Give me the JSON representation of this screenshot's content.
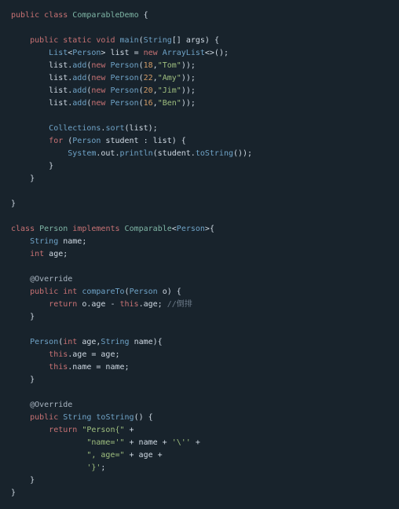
{
  "code": {
    "tokens": [
      {
        "c": "kw",
        "t": "public"
      },
      {
        "c": "pn",
        "t": " "
      },
      {
        "c": "kw",
        "t": "class"
      },
      {
        "c": "pn",
        "t": " "
      },
      {
        "c": "type",
        "t": "ComparableDemo"
      },
      {
        "c": "pn",
        "t": " {\n\n"
      },
      {
        "c": "pn",
        "t": "    "
      },
      {
        "c": "kw",
        "t": "public"
      },
      {
        "c": "pn",
        "t": " "
      },
      {
        "c": "kw",
        "t": "static"
      },
      {
        "c": "pn",
        "t": " "
      },
      {
        "c": "kw",
        "t": "void"
      },
      {
        "c": "pn",
        "t": " "
      },
      {
        "c": "fn",
        "t": "main"
      },
      {
        "c": "pn",
        "t": "("
      },
      {
        "c": "typeblue",
        "t": "String"
      },
      {
        "c": "pn",
        "t": "[] args) {\n"
      },
      {
        "c": "pn",
        "t": "        "
      },
      {
        "c": "typeblue",
        "t": "List"
      },
      {
        "c": "pn",
        "t": "<"
      },
      {
        "c": "typeblue",
        "t": "Person"
      },
      {
        "c": "pn",
        "t": "> list = "
      },
      {
        "c": "kw",
        "t": "new"
      },
      {
        "c": "pn",
        "t": " "
      },
      {
        "c": "typeblue",
        "t": "ArrayList"
      },
      {
        "c": "pn",
        "t": "<>();\n"
      },
      {
        "c": "pn",
        "t": "        list."
      },
      {
        "c": "fn",
        "t": "add"
      },
      {
        "c": "pn",
        "t": "("
      },
      {
        "c": "kw",
        "t": "new"
      },
      {
        "c": "pn",
        "t": " "
      },
      {
        "c": "typeblue",
        "t": "Person"
      },
      {
        "c": "pn",
        "t": "("
      },
      {
        "c": "num",
        "t": "18"
      },
      {
        "c": "pn",
        "t": ","
      },
      {
        "c": "str",
        "t": "\"Tom\""
      },
      {
        "c": "pn",
        "t": "));\n"
      },
      {
        "c": "pn",
        "t": "        list."
      },
      {
        "c": "fn",
        "t": "add"
      },
      {
        "c": "pn",
        "t": "("
      },
      {
        "c": "kw",
        "t": "new"
      },
      {
        "c": "pn",
        "t": " "
      },
      {
        "c": "typeblue",
        "t": "Person"
      },
      {
        "c": "pn",
        "t": "("
      },
      {
        "c": "num",
        "t": "22"
      },
      {
        "c": "pn",
        "t": ","
      },
      {
        "c": "str",
        "t": "\"Amy\""
      },
      {
        "c": "pn",
        "t": "));\n"
      },
      {
        "c": "pn",
        "t": "        list."
      },
      {
        "c": "fn",
        "t": "add"
      },
      {
        "c": "pn",
        "t": "("
      },
      {
        "c": "kw",
        "t": "new"
      },
      {
        "c": "pn",
        "t": " "
      },
      {
        "c": "typeblue",
        "t": "Person"
      },
      {
        "c": "pn",
        "t": "("
      },
      {
        "c": "num",
        "t": "20"
      },
      {
        "c": "pn",
        "t": ","
      },
      {
        "c": "str",
        "t": "\"Jim\""
      },
      {
        "c": "pn",
        "t": "));\n"
      },
      {
        "c": "pn",
        "t": "        list."
      },
      {
        "c": "fn",
        "t": "add"
      },
      {
        "c": "pn",
        "t": "("
      },
      {
        "c": "kw",
        "t": "new"
      },
      {
        "c": "pn",
        "t": " "
      },
      {
        "c": "typeblue",
        "t": "Person"
      },
      {
        "c": "pn",
        "t": "("
      },
      {
        "c": "num",
        "t": "16"
      },
      {
        "c": "pn",
        "t": ","
      },
      {
        "c": "str",
        "t": "\"Ben\""
      },
      {
        "c": "pn",
        "t": "));\n\n"
      },
      {
        "c": "pn",
        "t": "        "
      },
      {
        "c": "typeblue",
        "t": "Collections"
      },
      {
        "c": "pn",
        "t": "."
      },
      {
        "c": "fn",
        "t": "sort"
      },
      {
        "c": "pn",
        "t": "(list);\n"
      },
      {
        "c": "pn",
        "t": "        "
      },
      {
        "c": "kw",
        "t": "for"
      },
      {
        "c": "pn",
        "t": " ("
      },
      {
        "c": "typeblue",
        "t": "Person"
      },
      {
        "c": "pn",
        "t": " student : list) {\n"
      },
      {
        "c": "pn",
        "t": "            "
      },
      {
        "c": "typeblue",
        "t": "System"
      },
      {
        "c": "pn",
        "t": ".out."
      },
      {
        "c": "fn",
        "t": "println"
      },
      {
        "c": "pn",
        "t": "(student."
      },
      {
        "c": "fn",
        "t": "toString"
      },
      {
        "c": "pn",
        "t": "());\n"
      },
      {
        "c": "pn",
        "t": "        }\n"
      },
      {
        "c": "pn",
        "t": "    }\n\n"
      },
      {
        "c": "pn",
        "t": "}\n\n"
      },
      {
        "c": "kw",
        "t": "class"
      },
      {
        "c": "pn",
        "t": " "
      },
      {
        "c": "type",
        "t": "Person"
      },
      {
        "c": "pn",
        "t": " "
      },
      {
        "c": "kw",
        "t": "implements"
      },
      {
        "c": "pn",
        "t": " "
      },
      {
        "c": "type",
        "t": "Comparable"
      },
      {
        "c": "pn",
        "t": "<"
      },
      {
        "c": "typeblue",
        "t": "Person"
      },
      {
        "c": "pn",
        "t": ">{\n"
      },
      {
        "c": "pn",
        "t": "    "
      },
      {
        "c": "typeblue",
        "t": "String"
      },
      {
        "c": "pn",
        "t": " name;\n"
      },
      {
        "c": "pn",
        "t": "    "
      },
      {
        "c": "kw",
        "t": "int"
      },
      {
        "c": "pn",
        "t": " age;\n\n"
      },
      {
        "c": "pn",
        "t": "    "
      },
      {
        "c": "ann",
        "t": "@Override"
      },
      {
        "c": "pn",
        "t": "\n"
      },
      {
        "c": "pn",
        "t": "    "
      },
      {
        "c": "kw",
        "t": "public"
      },
      {
        "c": "pn",
        "t": " "
      },
      {
        "c": "kw",
        "t": "int"
      },
      {
        "c": "pn",
        "t": " "
      },
      {
        "c": "fn",
        "t": "compareTo"
      },
      {
        "c": "pn",
        "t": "("
      },
      {
        "c": "typeblue",
        "t": "Person"
      },
      {
        "c": "pn",
        "t": " o) {\n"
      },
      {
        "c": "pn",
        "t": "        "
      },
      {
        "c": "kw",
        "t": "return"
      },
      {
        "c": "pn",
        "t": " o.age - "
      },
      {
        "c": "kw",
        "t": "this"
      },
      {
        "c": "pn",
        "t": ".age; "
      },
      {
        "c": "cm",
        "t": "//倒排"
      },
      {
        "c": "pn",
        "t": "\n"
      },
      {
        "c": "pn",
        "t": "    }\n\n"
      },
      {
        "c": "pn",
        "t": "    "
      },
      {
        "c": "fn",
        "t": "Person"
      },
      {
        "c": "pn",
        "t": "("
      },
      {
        "c": "kw",
        "t": "int"
      },
      {
        "c": "pn",
        "t": " age,"
      },
      {
        "c": "typeblue",
        "t": "String"
      },
      {
        "c": "pn",
        "t": " name){\n"
      },
      {
        "c": "pn",
        "t": "        "
      },
      {
        "c": "kw",
        "t": "this"
      },
      {
        "c": "pn",
        "t": ".age = age;\n"
      },
      {
        "c": "pn",
        "t": "        "
      },
      {
        "c": "kw",
        "t": "this"
      },
      {
        "c": "pn",
        "t": ".name = name;\n"
      },
      {
        "c": "pn",
        "t": "    }\n\n"
      },
      {
        "c": "pn",
        "t": "    "
      },
      {
        "c": "ann",
        "t": "@Override"
      },
      {
        "c": "pn",
        "t": "\n"
      },
      {
        "c": "pn",
        "t": "    "
      },
      {
        "c": "kw",
        "t": "public"
      },
      {
        "c": "pn",
        "t": " "
      },
      {
        "c": "typeblue",
        "t": "String"
      },
      {
        "c": "pn",
        "t": " "
      },
      {
        "c": "fn",
        "t": "toString"
      },
      {
        "c": "pn",
        "t": "() {\n"
      },
      {
        "c": "pn",
        "t": "        "
      },
      {
        "c": "kw",
        "t": "return"
      },
      {
        "c": "pn",
        "t": " "
      },
      {
        "c": "str",
        "t": "\"Person{\""
      },
      {
        "c": "pn",
        "t": " +\n"
      },
      {
        "c": "pn",
        "t": "                "
      },
      {
        "c": "str",
        "t": "\"name='\""
      },
      {
        "c": "pn",
        "t": " + name + "
      },
      {
        "c": "str",
        "t": "'\\''"
      },
      {
        "c": "pn",
        "t": " +\n"
      },
      {
        "c": "pn",
        "t": "                "
      },
      {
        "c": "str",
        "t": "\", age=\""
      },
      {
        "c": "pn",
        "t": " + age +\n"
      },
      {
        "c": "pn",
        "t": "                "
      },
      {
        "c": "str",
        "t": "'}'"
      },
      {
        "c": "pn",
        "t": ";\n"
      },
      {
        "c": "pn",
        "t": "    }\n"
      },
      {
        "c": "pn",
        "t": "}\n"
      }
    ]
  }
}
